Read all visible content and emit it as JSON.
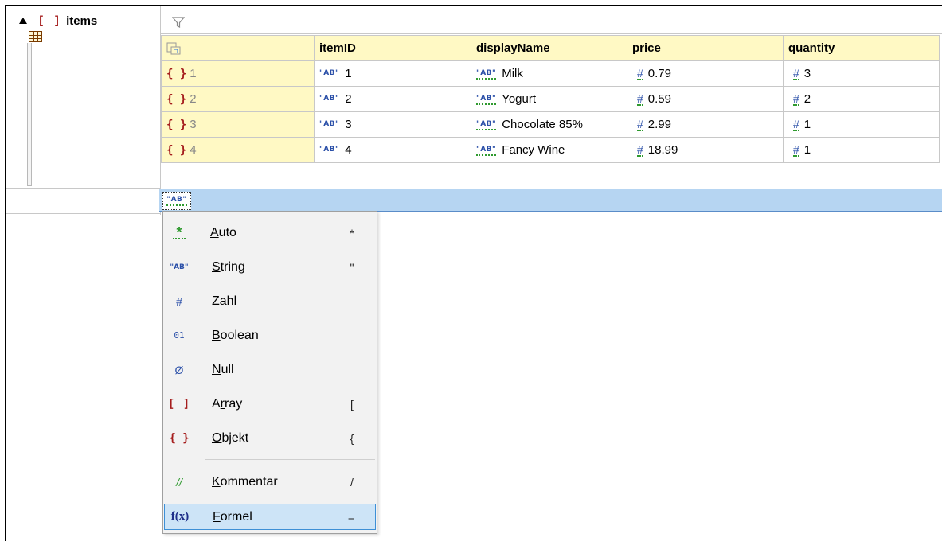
{
  "tree": {
    "label": "items",
    "array_icon": "[ ]"
  },
  "grid": {
    "columns": [
      "",
      "itemID",
      "displayName",
      "price",
      "quantity"
    ],
    "rows": [
      {
        "num": "1",
        "itemID": "1",
        "displayName": "Milk",
        "price": "0.79",
        "quantity": "3"
      },
      {
        "num": "2",
        "itemID": "2",
        "displayName": "Yogurt",
        "price": "0.59",
        "quantity": "2"
      },
      {
        "num": "3",
        "itemID": "3",
        "displayName": "Chocolate 85%",
        "price": "2.99",
        "quantity": "1"
      },
      {
        "num": "4",
        "itemID": "4",
        "displayName": "Fancy Wine",
        "price": "18.99",
        "quantity": "1"
      }
    ],
    "object_icon": "{ }",
    "string_icon": "\"AB\"",
    "number_icon": "#"
  },
  "new_cell": {
    "icon": "\"AB\""
  },
  "menu": {
    "items": [
      {
        "icon": "*",
        "label": "Auto",
        "u": "A",
        "rest": "uto",
        "shortcut": "*"
      },
      {
        "icon": "\"AB\"",
        "label": "String",
        "u": "S",
        "rest": "tring",
        "shortcut": "\""
      },
      {
        "icon": "#",
        "label": "Zahl",
        "u": "Z",
        "rest": "ahl",
        "shortcut": ""
      },
      {
        "icon": "01",
        "label": "Boolean",
        "u": "B",
        "rest": "oolean",
        "shortcut": ""
      },
      {
        "icon": "Ø",
        "label": "Null",
        "u": "N",
        "rest": "ull",
        "shortcut": ""
      },
      {
        "icon": "[ ]",
        "label": "Array",
        "pre": "A",
        "u": "r",
        "rest": "ray",
        "shortcut": "["
      },
      {
        "icon": "{ }",
        "label": "Objekt",
        "u": "O",
        "rest": "bjekt",
        "shortcut": "{"
      },
      {
        "icon": "//",
        "label": "Kommentar",
        "u": "K",
        "rest": "ommentar",
        "shortcut": "/"
      },
      {
        "icon": "f(x)",
        "label": "Formel",
        "u": "F",
        "rest": "ormel",
        "shortcut": "="
      }
    ]
  },
  "colors": {
    "header_bg": "#fff9c4",
    "selection": "#b6d5f2",
    "bracket": "#a51d1d",
    "type_blue": "#2a4fa8",
    "type_green": "#2f9a2f"
  }
}
